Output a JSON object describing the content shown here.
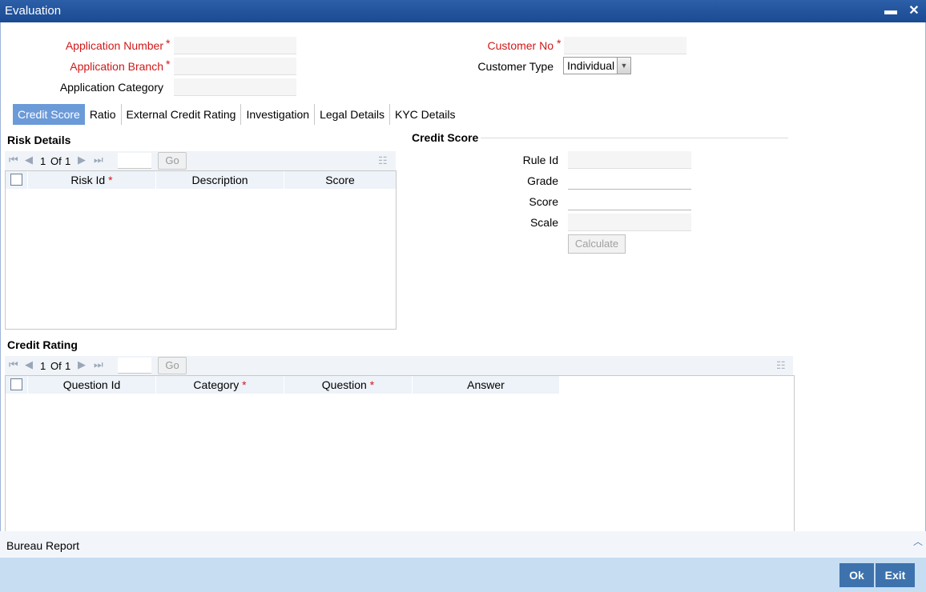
{
  "window": {
    "title": "Evaluation"
  },
  "header": {
    "application_number": {
      "label": "Application Number",
      "value": ""
    },
    "application_branch": {
      "label": "Application Branch",
      "value": ""
    },
    "application_category": {
      "label": "Application Category",
      "value": ""
    },
    "customer_no": {
      "label": "Customer No",
      "value": ""
    },
    "customer_type": {
      "label": "Customer Type",
      "value": "Individual"
    },
    "required_mark": "*"
  },
  "tabs": [
    {
      "label": "Credit Score",
      "active": true
    },
    {
      "label": "Ratio"
    },
    {
      "label": "External Credit Rating"
    },
    {
      "label": "Investigation"
    },
    {
      "label": "Legal Details"
    },
    {
      "label": "KYC Details"
    }
  ],
  "risk_details": {
    "title": "Risk Details",
    "pager": {
      "current": "1",
      "of_label": "Of",
      "total": "1",
      "go_label": "Go"
    },
    "columns": [
      "Risk Id",
      "Description",
      "Score"
    ]
  },
  "credit_score": {
    "title": "Credit Score",
    "rule_id": {
      "label": "Rule Id",
      "value": ""
    },
    "grade": {
      "label": "Grade",
      "value": ""
    },
    "score": {
      "label": "Score",
      "value": ""
    },
    "scale": {
      "label": "Scale",
      "value": ""
    },
    "calculate_label": "Calculate"
  },
  "credit_rating": {
    "title": "Credit Rating",
    "pager": {
      "current": "1",
      "of_label": "Of",
      "total": "1",
      "go_label": "Go"
    },
    "columns": [
      "Question Id",
      "Category",
      "Question",
      "Answer"
    ]
  },
  "bottom": {
    "bureau_report": "Bureau Report"
  },
  "footer": {
    "ok_label": "Ok",
    "exit_label": "Exit"
  },
  "colors": {
    "titlebar": "#1a4a92",
    "required": "#d01818",
    "active_tab": "#6b9ad8",
    "footer": "#c7ddf2",
    "button": "#3d72ad"
  },
  "icons": [
    "minimize-icon",
    "close-icon",
    "first-page-icon",
    "prev-page-icon",
    "next-page-icon",
    "last-page-icon",
    "list-icon",
    "dropdown-arrow-icon",
    "collapse-up-icon"
  ]
}
